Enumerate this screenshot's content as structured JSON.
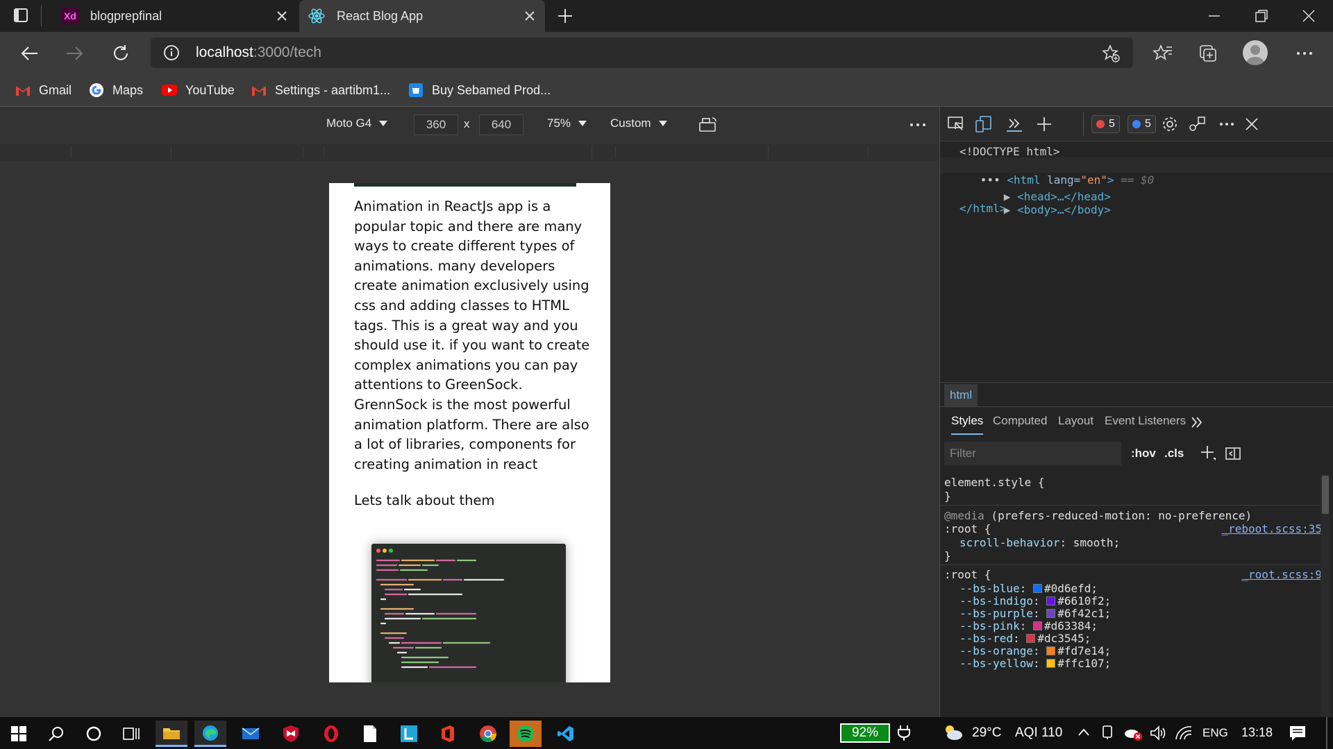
{
  "tabs": [
    {
      "title": "blogprepfinal",
      "favicon": "xd-icon"
    },
    {
      "title": "React Blog App",
      "favicon": "react-icon",
      "active": true
    }
  ],
  "address": {
    "host": "localhost",
    "path": ":3000/tech"
  },
  "bookmarks": [
    {
      "label": "Gmail",
      "icon": "gmail-icon"
    },
    {
      "label": "Maps",
      "icon": "google-icon"
    },
    {
      "label": "YouTube",
      "icon": "youtube-icon"
    },
    {
      "label": "Settings - aartibm1...",
      "icon": "gmail-icon"
    },
    {
      "label": "Buy Sebamed Prod...",
      "icon": "shop-icon"
    }
  ],
  "device_toolbar": {
    "device": "Moto G4",
    "width": "360",
    "height": "640",
    "times": "x",
    "zoom": "75%",
    "throttle": "Custom"
  },
  "article": {
    "paragraph1": "Animation in ReactJs app is a popular topic and there are many ways to create different types of animations. many developers create animation exclusively using css and adding classes to HTML tags. This is a great way and you should use it. if you want to create complex animations you can pay attentions to GreenSock. GrennSock is the most powerful animation platform. There are also a lot of libraries, components for creating animation in react",
    "paragraph2": "Lets talk about them"
  },
  "devtools": {
    "errors": "5",
    "messages": "5",
    "dom": {
      "doctype": "<!DOCTYPE html>",
      "html_open_tag": "<html",
      "html_attr_name": " lang=",
      "html_attr_value": "\"en\"",
      "html_open_close": ">",
      "selected_marker": " == $0",
      "head": "<head>…</head>",
      "body": "<body>…</body>",
      "html_close": "</html>"
    },
    "breadcrumb": "html",
    "tabs": [
      "Styles",
      "Computed",
      "Layout",
      "Event Listeners"
    ],
    "filter_placeholder": "Filter",
    "hov": ":hov",
    "cls": ".cls",
    "styles": {
      "element_style_open": "element.style {",
      "close": "}",
      "media_keyword": "@media",
      "media_query": " (prefers-reduced-motion: no-preference)",
      "root_open": ":root {",
      "scroll_prop": "scroll-behavior",
      "scroll_val": "smooth;",
      "reboot_link": "_reboot.scss:35",
      "root_link": "_root.scss:9",
      "vars": [
        {
          "name": "--bs-blue",
          "value": "#0d6efd;",
          "color": "#0d6efd"
        },
        {
          "name": "--bs-indigo",
          "value": "#6610f2;",
          "color": "#6610f2"
        },
        {
          "name": "--bs-purple",
          "value": "#6f42c1;",
          "color": "#6f42c1"
        },
        {
          "name": "--bs-pink",
          "value": "#d63384;",
          "color": "#d63384"
        },
        {
          "name": "--bs-red",
          "value": "#dc3545;",
          "color": "#dc3545"
        },
        {
          "name": "--bs-orange",
          "value": "#fd7e14;",
          "color": "#fd7e14"
        },
        {
          "name": "--bs-yellow",
          "value": "#ffc107;",
          "color": "#ffc107"
        }
      ]
    }
  },
  "taskbar": {
    "battery": "92%",
    "weather": "29°C",
    "aqi": "AQI 110",
    "language": "ENG",
    "time": "13:18"
  }
}
